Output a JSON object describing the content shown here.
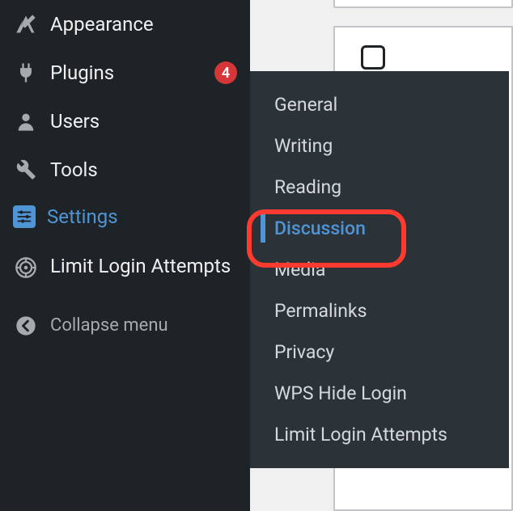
{
  "sidebar": {
    "items": [
      {
        "label": "Appearance",
        "icon": "appearance"
      },
      {
        "label": "Plugins",
        "icon": "plugins",
        "badge": "4"
      },
      {
        "label": "Users",
        "icon": "users"
      },
      {
        "label": "Tools",
        "icon": "tools"
      },
      {
        "label": "Settings",
        "icon": "settings",
        "active": true
      },
      {
        "label": "Limit Login At­tempts",
        "icon": "limit-login"
      }
    ],
    "collapse_label": "Collapse menu"
  },
  "submenu": {
    "items": [
      {
        "label": "General"
      },
      {
        "label": "Writing"
      },
      {
        "label": "Reading"
      },
      {
        "label": "Discussion",
        "current": true,
        "highlighted": true
      },
      {
        "label": "Media"
      },
      {
        "label": "Permalinks"
      },
      {
        "label": "Privacy"
      },
      {
        "label": "WPS Hide Login"
      },
      {
        "label": "Limit Login Attempts"
      }
    ]
  },
  "colors": {
    "accent": "#4f94d4",
    "badge": "#d63638",
    "highlight": "#ff3b30",
    "sidebar_bg": "#1d2327",
    "submenu_bg": "#2c3338"
  }
}
